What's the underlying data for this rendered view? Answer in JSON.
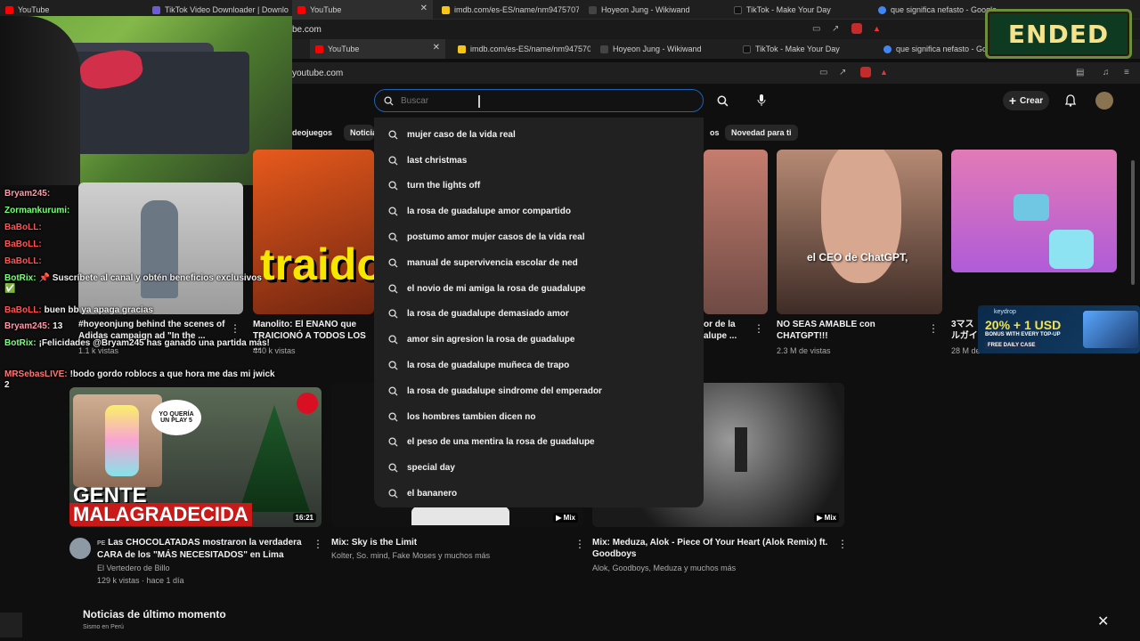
{
  "outer_tabs": [
    {
      "label": "YouTube",
      "color": "#ff0000"
    },
    {
      "label": "TikTok Video Downloader | Downlo",
      "color": "#6b5bd6"
    },
    {
      "label": "YouTube",
      "color": "#ff0000"
    },
    {
      "label": "imdb.com/es-ES/name/nm9475707/",
      "color": "#f5c518"
    },
    {
      "label": "Hoyeon Jung - Wikiwand",
      "color": "#333333"
    },
    {
      "label": "TikTok - Make Your Day",
      "color": "#111111"
    },
    {
      "label": "que significa nefasto - Google",
      "color": "#4285f4"
    }
  ],
  "outer_address": "be.com",
  "ended_badge": "ENDED",
  "inner_tabs": [
    {
      "label": "YouTube",
      "color": "#ff0000"
    },
    {
      "label": "imdb.com/es-ES/name/nm9475707/",
      "color": "#f5c518"
    },
    {
      "label": "Hoyeon Jung - Wikiwand",
      "color": "#333333"
    },
    {
      "label": "TikTok - Make Your Day",
      "color": "#111111"
    },
    {
      "label": "que significa nefasto - Google",
      "color": "#4285f4"
    }
  ],
  "inner_address": "youtube.com",
  "header": {
    "search_placeholder": "Buscar",
    "create_label": "Crear"
  },
  "chips": {
    "left1": "deojuegos",
    "left2": "Noticia",
    "right1": "os",
    "right2": "Novedad para ti"
  },
  "suggestions": [
    "mujer caso de la vida real",
    "last christmas",
    "turn the lights off",
    "la rosa de guadalupe amor compartido",
    "postumo amor mujer casos de la vida real",
    "manual de supervivencia escolar de ned",
    "el novio de mi amiga la rosa de guadalupe",
    "la rosa de guadalupe demasiado amor",
    "amor sin agresion la rosa de guadalupe",
    "la rosa de guadalupe muñeca de trapo",
    "la rosa de guadalupe sindrome del emperador",
    "los hombres tambien dicen no",
    "el peso de una mentira la rosa de guadalupe",
    "special day",
    "el bananero"
  ],
  "videos_row1": [
    {
      "title": "#hoyeonjung behind the scenes of Adidas campaign ad \"In the ...",
      "meta": "1.1 k vistas"
    },
    {
      "title": "Manolito: El ENANO que TRAICIONÓ A TODOS LOS ...",
      "meta": "440 k vistas",
      "thumb_text": "traido"
    },
    {
      "title": "or de la alupe ...",
      "meta": ""
    },
    {
      "title": "NO SEAS AMABLE con CHATGPT!!!",
      "meta": "2.3 M de vistas",
      "thumb_text": "el CEO de ChatGPT,"
    },
    {
      "title": "3マス ルガイ",
      "meta": "28 M de"
    }
  ],
  "videos_row2": [
    {
      "title": "Las CHOCOLATADAS mostraron la verdadera CARA de los \"MÁS NECESITADOS\" en Lima",
      "channel": "El Vertedero de Billo",
      "meta": "129 k vistas · hace 1 día",
      "duration": "16:21",
      "flag": "PE",
      "thumb_text1": "GENTE",
      "thumb_text2": "MALAGRADECIDA",
      "bubble": "YO QUERÍA UN PLAY 5"
    },
    {
      "title": "Mix: Sky is the Limit",
      "channel": "Kolter, So. mind, Fake Moses y muchos más",
      "badge": "Mix"
    },
    {
      "title": "Mix: Meduza, Alok - Piece Of Your Heart (Alok Remix) ft. Goodboys",
      "channel": "Alok, Goodboys, Meduza y muchos más",
      "badge": "Mix"
    }
  ],
  "news": {
    "title": "Noticias de último momento",
    "subtitle": "Sismo en Perú"
  },
  "chat": [
    {
      "user": "Bryam245:",
      "text": "",
      "color": "#ff9aa8"
    },
    {
      "user": "Zormankurumi:",
      "text": "",
      "color": "#7cff7c"
    },
    {
      "user": "BaBoLL:",
      "text": "",
      "color": "#ff5555"
    },
    {
      "user": "BaBoLL:",
      "text": "",
      "color": "#ff5555"
    },
    {
      "user": "BaBoLL:",
      "text": "",
      "color": "#ff5555"
    },
    {
      "user": "BotRix:",
      "text": "📌 Suscríbete al canal y obtén beneficios exclusivos ✅",
      "color": "#7cff7c"
    },
    {
      "user": "BaBoLL:",
      "text": "buen bb ya apaga gracias",
      "color": "#ff5555"
    },
    {
      "user": "Bryam245:",
      "text": "13",
      "color": "#ff9aa8"
    },
    {
      "user": "BotRix:",
      "text": "¡Felicidades @Bryam245 has ganado una partida más!",
      "color": "#7cff7c"
    },
    {
      "user": "MRSebasLIVE:",
      "text": "!bodo gordo roblocs a que hora me das mi jwick 2",
      "color": "#ff7777"
    }
  ],
  "keydrop": {
    "brand": "keydrop",
    "offer": "20% + 1 USD",
    "sub": "BONUS WITH EVERY TOP-UP",
    "cta": "FREE DAILY CASE"
  }
}
